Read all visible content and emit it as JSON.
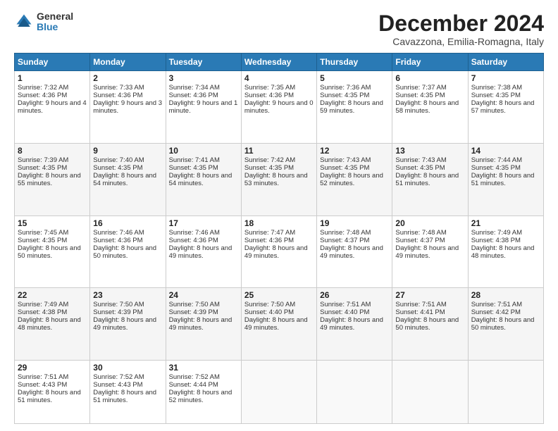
{
  "logo": {
    "general": "General",
    "blue": "Blue"
  },
  "header": {
    "title": "December 2024",
    "subtitle": "Cavazzona, Emilia-Romagna, Italy"
  },
  "days_of_week": [
    "Sunday",
    "Monday",
    "Tuesday",
    "Wednesday",
    "Thursday",
    "Friday",
    "Saturday"
  ],
  "weeks": [
    [
      {
        "day": "1",
        "sunrise": "7:32 AM",
        "sunset": "4:36 PM",
        "daylight": "9 hours and 4 minutes."
      },
      {
        "day": "2",
        "sunrise": "7:33 AM",
        "sunset": "4:36 PM",
        "daylight": "9 hours and 3 minutes."
      },
      {
        "day": "3",
        "sunrise": "7:34 AM",
        "sunset": "4:36 PM",
        "daylight": "9 hours and 1 minute."
      },
      {
        "day": "4",
        "sunrise": "7:35 AM",
        "sunset": "4:36 PM",
        "daylight": "9 hours and 0 minutes."
      },
      {
        "day": "5",
        "sunrise": "7:36 AM",
        "sunset": "4:35 PM",
        "daylight": "8 hours and 59 minutes."
      },
      {
        "day": "6",
        "sunrise": "7:37 AM",
        "sunset": "4:35 PM",
        "daylight": "8 hours and 58 minutes."
      },
      {
        "day": "7",
        "sunrise": "7:38 AM",
        "sunset": "4:35 PM",
        "daylight": "8 hours and 57 minutes."
      }
    ],
    [
      {
        "day": "8",
        "sunrise": "7:39 AM",
        "sunset": "4:35 PM",
        "daylight": "8 hours and 55 minutes."
      },
      {
        "day": "9",
        "sunrise": "7:40 AM",
        "sunset": "4:35 PM",
        "daylight": "8 hours and 54 minutes."
      },
      {
        "day": "10",
        "sunrise": "7:41 AM",
        "sunset": "4:35 PM",
        "daylight": "8 hours and 54 minutes."
      },
      {
        "day": "11",
        "sunrise": "7:42 AM",
        "sunset": "4:35 PM",
        "daylight": "8 hours and 53 minutes."
      },
      {
        "day": "12",
        "sunrise": "7:43 AM",
        "sunset": "4:35 PM",
        "daylight": "8 hours and 52 minutes."
      },
      {
        "day": "13",
        "sunrise": "7:43 AM",
        "sunset": "4:35 PM",
        "daylight": "8 hours and 51 minutes."
      },
      {
        "day": "14",
        "sunrise": "7:44 AM",
        "sunset": "4:35 PM",
        "daylight": "8 hours and 51 minutes."
      }
    ],
    [
      {
        "day": "15",
        "sunrise": "7:45 AM",
        "sunset": "4:35 PM",
        "daylight": "8 hours and 50 minutes."
      },
      {
        "day": "16",
        "sunrise": "7:46 AM",
        "sunset": "4:36 PM",
        "daylight": "8 hours and 50 minutes."
      },
      {
        "day": "17",
        "sunrise": "7:46 AM",
        "sunset": "4:36 PM",
        "daylight": "8 hours and 49 minutes."
      },
      {
        "day": "18",
        "sunrise": "7:47 AM",
        "sunset": "4:36 PM",
        "daylight": "8 hours and 49 minutes."
      },
      {
        "day": "19",
        "sunrise": "7:48 AM",
        "sunset": "4:37 PM",
        "daylight": "8 hours and 49 minutes."
      },
      {
        "day": "20",
        "sunrise": "7:48 AM",
        "sunset": "4:37 PM",
        "daylight": "8 hours and 49 minutes."
      },
      {
        "day": "21",
        "sunrise": "7:49 AM",
        "sunset": "4:38 PM",
        "daylight": "8 hours and 48 minutes."
      }
    ],
    [
      {
        "day": "22",
        "sunrise": "7:49 AM",
        "sunset": "4:38 PM",
        "daylight": "8 hours and 48 minutes."
      },
      {
        "day": "23",
        "sunrise": "7:50 AM",
        "sunset": "4:39 PM",
        "daylight": "8 hours and 49 minutes."
      },
      {
        "day": "24",
        "sunrise": "7:50 AM",
        "sunset": "4:39 PM",
        "daylight": "8 hours and 49 minutes."
      },
      {
        "day": "25",
        "sunrise": "7:50 AM",
        "sunset": "4:40 PM",
        "daylight": "8 hours and 49 minutes."
      },
      {
        "day": "26",
        "sunrise": "7:51 AM",
        "sunset": "4:40 PM",
        "daylight": "8 hours and 49 minutes."
      },
      {
        "day": "27",
        "sunrise": "7:51 AM",
        "sunset": "4:41 PM",
        "daylight": "8 hours and 50 minutes."
      },
      {
        "day": "28",
        "sunrise": "7:51 AM",
        "sunset": "4:42 PM",
        "daylight": "8 hours and 50 minutes."
      }
    ],
    [
      {
        "day": "29",
        "sunrise": "7:51 AM",
        "sunset": "4:43 PM",
        "daylight": "8 hours and 51 minutes."
      },
      {
        "day": "30",
        "sunrise": "7:52 AM",
        "sunset": "4:43 PM",
        "daylight": "8 hours and 51 minutes."
      },
      {
        "day": "31",
        "sunrise": "7:52 AM",
        "sunset": "4:44 PM",
        "daylight": "8 hours and 52 minutes."
      },
      null,
      null,
      null,
      null
    ]
  ]
}
